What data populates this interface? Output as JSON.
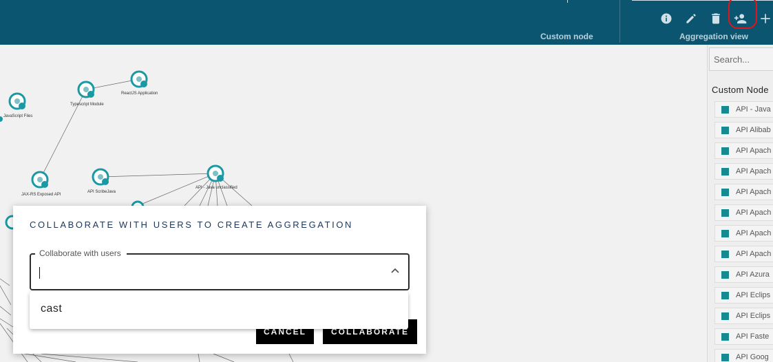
{
  "header": {
    "custom_node_label": "Custom node",
    "aggregation_view_label": "Aggregation view",
    "toolbar_icons": [
      "info-icon",
      "edit-pencil-icon",
      "delete-trash-icon",
      "add-user-icon",
      "add-plus-icon"
    ],
    "highlight_color": "#e0141b",
    "background_color": "#0c5571"
  },
  "graph": {
    "nodes": [
      {
        "label": "ReactJS Application"
      },
      {
        "label": "Typescript Module"
      },
      {
        "label": "JavaScript Files"
      },
      {
        "label": "JAX-RS Exposed API"
      },
      {
        "label": "API ScribeJava"
      },
      {
        "label": "API - Java unclassified"
      }
    ],
    "node_color": "#1a98a3"
  },
  "right_panel": {
    "search_placeholder": "Search...",
    "heading": "Custom Node",
    "items": [
      "API - Java",
      "API Alibab",
      "API Apach",
      "API Apach",
      "API Apach",
      "API Apach",
      "API Apach",
      "API Apach",
      "API Azura",
      "API Eclips",
      "API Eclips",
      "API Faste",
      "API Goog"
    ],
    "item_color": "#168a91"
  },
  "modal": {
    "title": "COLLABORATE WITH USERS TO CREATE AGGREGATION",
    "field_label": "Collaborate with users",
    "field_value": "",
    "cancel_label": "CANCEL",
    "collaborate_label": "COLLABORATE"
  },
  "dropdown": {
    "options": [
      "cast"
    ]
  }
}
